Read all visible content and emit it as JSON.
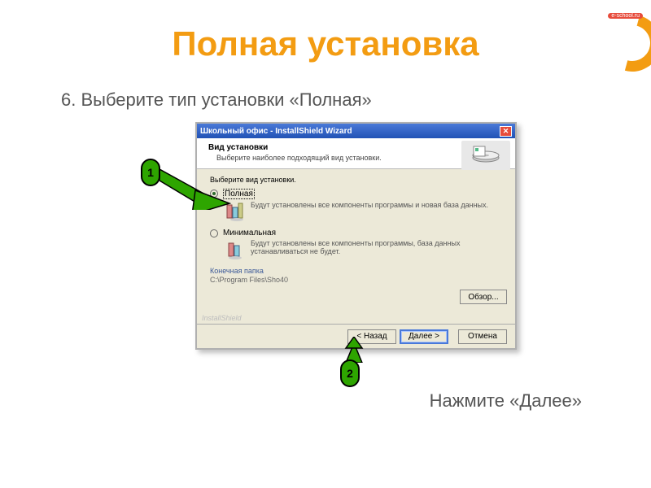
{
  "page": {
    "title": "Полная установка",
    "instruction": "6. Выберите тип установки «Полная»",
    "caption": "Нажмите «Далее»"
  },
  "logo": {
    "site": "e-school.ru"
  },
  "callouts": {
    "badge1": "1",
    "badge2": "2"
  },
  "installer": {
    "titlebar": "Школьный офис - InstallShield Wizard",
    "header_title": "Вид установки",
    "header_sub": "Выберите наиболее подходящий вид установки.",
    "prompt": "Выберите вид установки.",
    "option_full_label": "Полная",
    "option_full_desc": "Будут установлены все компоненты программы и новая база данных.",
    "option_min_label": "Минимальная",
    "option_min_desc": "Будут установлены все компоненты программы, база данных устанавливаться не будет.",
    "dest_label": "Конечная папка",
    "dest_path": "C:\\Program Files\\Sho40",
    "browse": "Обзор...",
    "watermark": "InstallShield",
    "back": "< Назад",
    "next": "Далее >",
    "cancel": "Отмена"
  }
}
